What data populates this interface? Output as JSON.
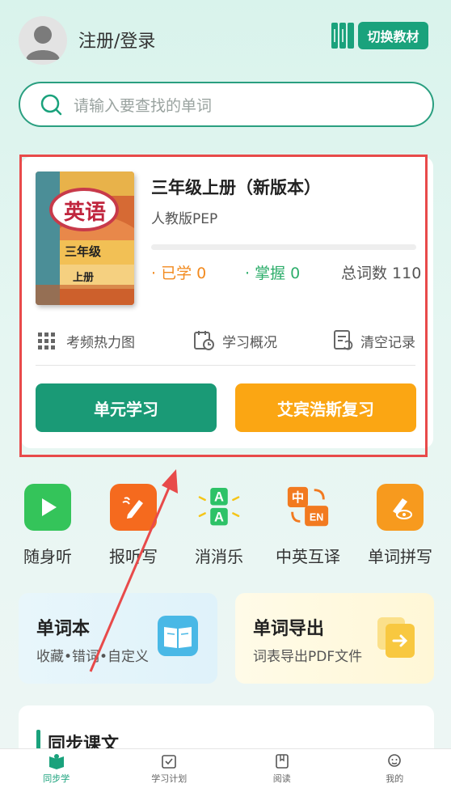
{
  "header": {
    "login_label": "注册/登录",
    "switch_label": "切换教材"
  },
  "search": {
    "placeholder": "请输入要查找的单词"
  },
  "book": {
    "cover_title": "英语",
    "cover_grade": "三年级",
    "cover_volume": "上册",
    "title": "三年级上册（新版本）",
    "publisher": "人教版PEP",
    "progress_fraction": 0,
    "learned_label": "· 已学 0",
    "mastered_label": "· 掌握 0",
    "total_label": "总词数 110"
  },
  "tools": [
    {
      "label": "考频热力图",
      "icon": "grid-icon"
    },
    {
      "label": "学习概况",
      "icon": "calendar-clock-icon"
    },
    {
      "label": "清空记录",
      "icon": "clear-record-icon"
    }
  ],
  "buttons": {
    "unit_study": "单元学习",
    "review": "艾宾浩斯复习"
  },
  "features": [
    {
      "label": "随身听",
      "icon": "play-icon",
      "color": "#34c45a"
    },
    {
      "label": "报听写",
      "icon": "pencil-icon",
      "color": "#f56a1e"
    },
    {
      "label": "消消乐",
      "icon": "letter-a-icon",
      "color": "#2dc267"
    },
    {
      "label": "中英互译",
      "icon": "translate-icon",
      "color": "#f27a20"
    },
    {
      "label": "单词拼写",
      "icon": "spell-icon",
      "color": "#f79a1e"
    }
  ],
  "tiles": [
    {
      "title": "单词本",
      "subtitle": "收藏•错词•自定义"
    },
    {
      "title": "单词导出",
      "subtitle": "词表导出PDF文件"
    }
  ],
  "sync": {
    "title": "同步课文"
  },
  "tabbar": [
    {
      "label": "同步学",
      "active": true
    },
    {
      "label": "学习计划"
    },
    {
      "label": "阅读"
    },
    {
      "label": "我的"
    }
  ],
  "colors": {
    "primary": "#1aa27c",
    "orange": "#fba613",
    "annotation": "#e84a4a"
  }
}
